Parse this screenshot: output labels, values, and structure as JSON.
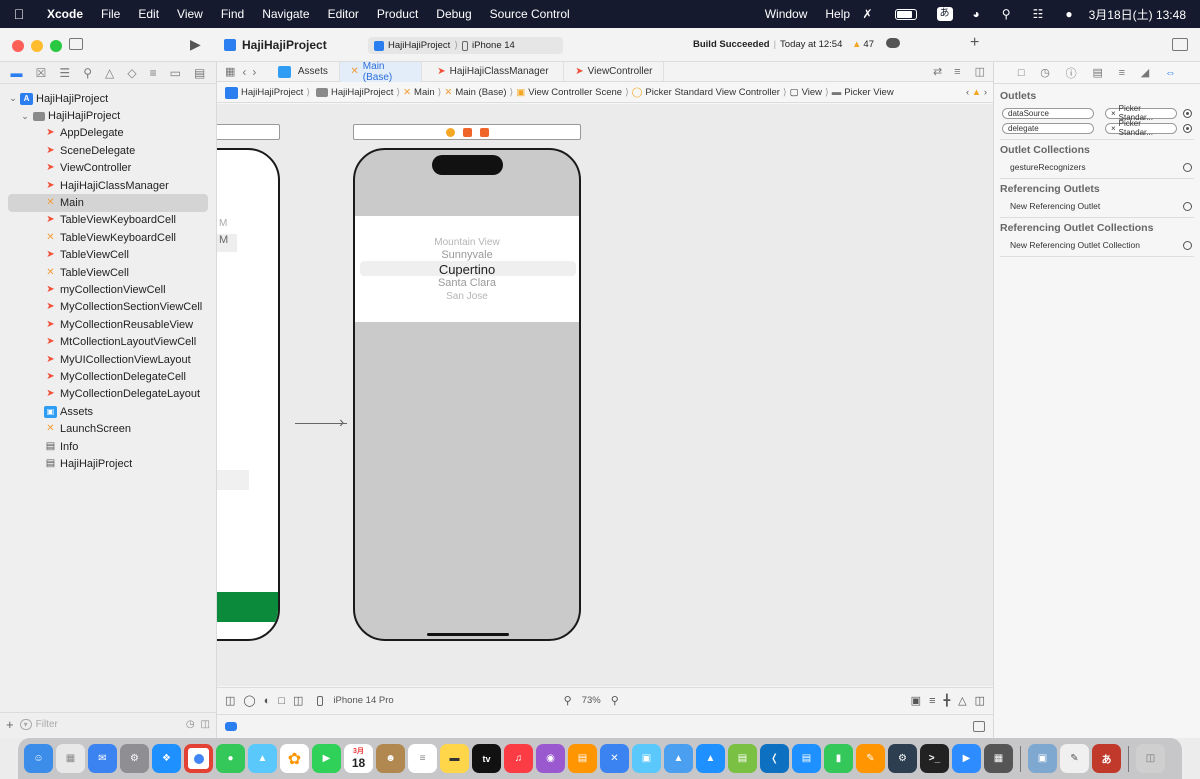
{
  "menubar": {
    "apple": "",
    "app_name": "Xcode",
    "items": [
      "File",
      "Edit",
      "View",
      "Find",
      "Navigate",
      "Editor",
      "Product",
      "Debug",
      "Source Control",
      "Window",
      "Help"
    ],
    "ime_label": "あ",
    "datetime": "3月18日(土) 13:48"
  },
  "toolbar": {
    "project_title": "HajiHajiProject",
    "scheme": "HajiHajiProject",
    "destination": "iPhone 14",
    "status_bold": "Build Succeeded",
    "status_rest": "Today at 12:54",
    "warning_count": "47",
    "add_label": "+"
  },
  "navigator": {
    "items": [
      {
        "label": "HajiHajiProject",
        "icon": "project-icon",
        "type": "project"
      },
      {
        "label": "HajiHajiProject",
        "icon": "folder-icon",
        "type": "folder"
      },
      {
        "label": "AppDelegate",
        "icon": "swift-file-icon",
        "type": "swift"
      },
      {
        "label": "SceneDelegate",
        "icon": "swift-file-icon",
        "type": "swift"
      },
      {
        "label": "ViewController",
        "icon": "swift-file-icon",
        "type": "swift"
      },
      {
        "label": "HajiHajiClassManager",
        "icon": "swift-file-icon",
        "type": "swift"
      },
      {
        "label": "Main",
        "icon": "storyboard-icon",
        "type": "xib"
      },
      {
        "label": "TableViewKeyboardCell",
        "icon": "swift-file-icon",
        "type": "swift"
      },
      {
        "label": "TableViewKeyboardCell",
        "icon": "xib-icon",
        "type": "xib"
      },
      {
        "label": "TableViewCell",
        "icon": "swift-file-icon",
        "type": "swift"
      },
      {
        "label": "TableViewCell",
        "icon": "xib-icon",
        "type": "xib"
      },
      {
        "label": "myCollectionViewCell",
        "icon": "swift-file-icon",
        "type": "swift"
      },
      {
        "label": "MyCollectionSectionViewCell",
        "icon": "swift-file-icon",
        "type": "swift"
      },
      {
        "label": "MyCollectionReusableView",
        "icon": "swift-file-icon",
        "type": "swift"
      },
      {
        "label": "MtCollectionLayoutViewCell",
        "icon": "swift-file-icon",
        "type": "swift"
      },
      {
        "label": "MyUICollectionViewLayout",
        "icon": "swift-file-icon",
        "type": "swift"
      },
      {
        "label": "MyCollectionDelegateCell",
        "icon": "swift-file-icon",
        "type": "swift"
      },
      {
        "label": "MyCollectionDelegateLayout",
        "icon": "swift-file-icon",
        "type": "swift"
      },
      {
        "label": "Assets",
        "icon": "assets-icon",
        "type": "assets"
      },
      {
        "label": "LaunchScreen",
        "icon": "storyboard-icon",
        "type": "xib"
      },
      {
        "label": "Info",
        "icon": "plist-icon",
        "type": "plist"
      },
      {
        "label": "HajiHajiProject",
        "icon": "project-settings-icon",
        "type": "plist"
      }
    ],
    "selected_index": 6,
    "filter_placeholder": "Filter"
  },
  "editor": {
    "tabs": [
      "Assets",
      "Main (Base)",
      "HajiHajiClassManager",
      "ViewController"
    ],
    "active_tab": 1,
    "breadcrumb": [
      "HajiHajiProject",
      "HajiHajiProject",
      "Main",
      "Main (Base)",
      "View Controller Scene",
      "Picker Standard View Controller",
      "View",
      "Picker View"
    ],
    "picker_rows": [
      "Mountain View",
      "Sunnyvale",
      "Cupertino",
      "Santa Clara",
      "San Jose"
    ],
    "selected_picker_row": 2,
    "left_scene_fragment": [
      "M",
      "M"
    ],
    "device_label": "iPhone 14 Pro",
    "zoom": "73%"
  },
  "inspector": {
    "outlets_title": "Outlets",
    "outlets": [
      {
        "name": "dataSource",
        "target": "Picker Standar..."
      },
      {
        "name": "delegate",
        "target": "Picker Standar..."
      }
    ],
    "collections_title": "Outlet Collections",
    "collections": [
      "gestureRecognizers"
    ],
    "referencing_title": "Referencing Outlets",
    "referencing": [
      "New Referencing Outlet"
    ],
    "ref_collections_title": "Referencing Outlet Collections",
    "ref_collections": [
      "New Referencing Outlet Collection"
    ]
  },
  "dock": {
    "calendar_month": "3月",
    "calendar_day": "18",
    "tv_label": "tv",
    "ime_label": "あ"
  },
  "colors": {
    "accent": "#2a6fdb",
    "swift": "#f05138",
    "storyboard": "#f29d38",
    "menubar": "#151a2e",
    "warning": "#f5a623"
  }
}
